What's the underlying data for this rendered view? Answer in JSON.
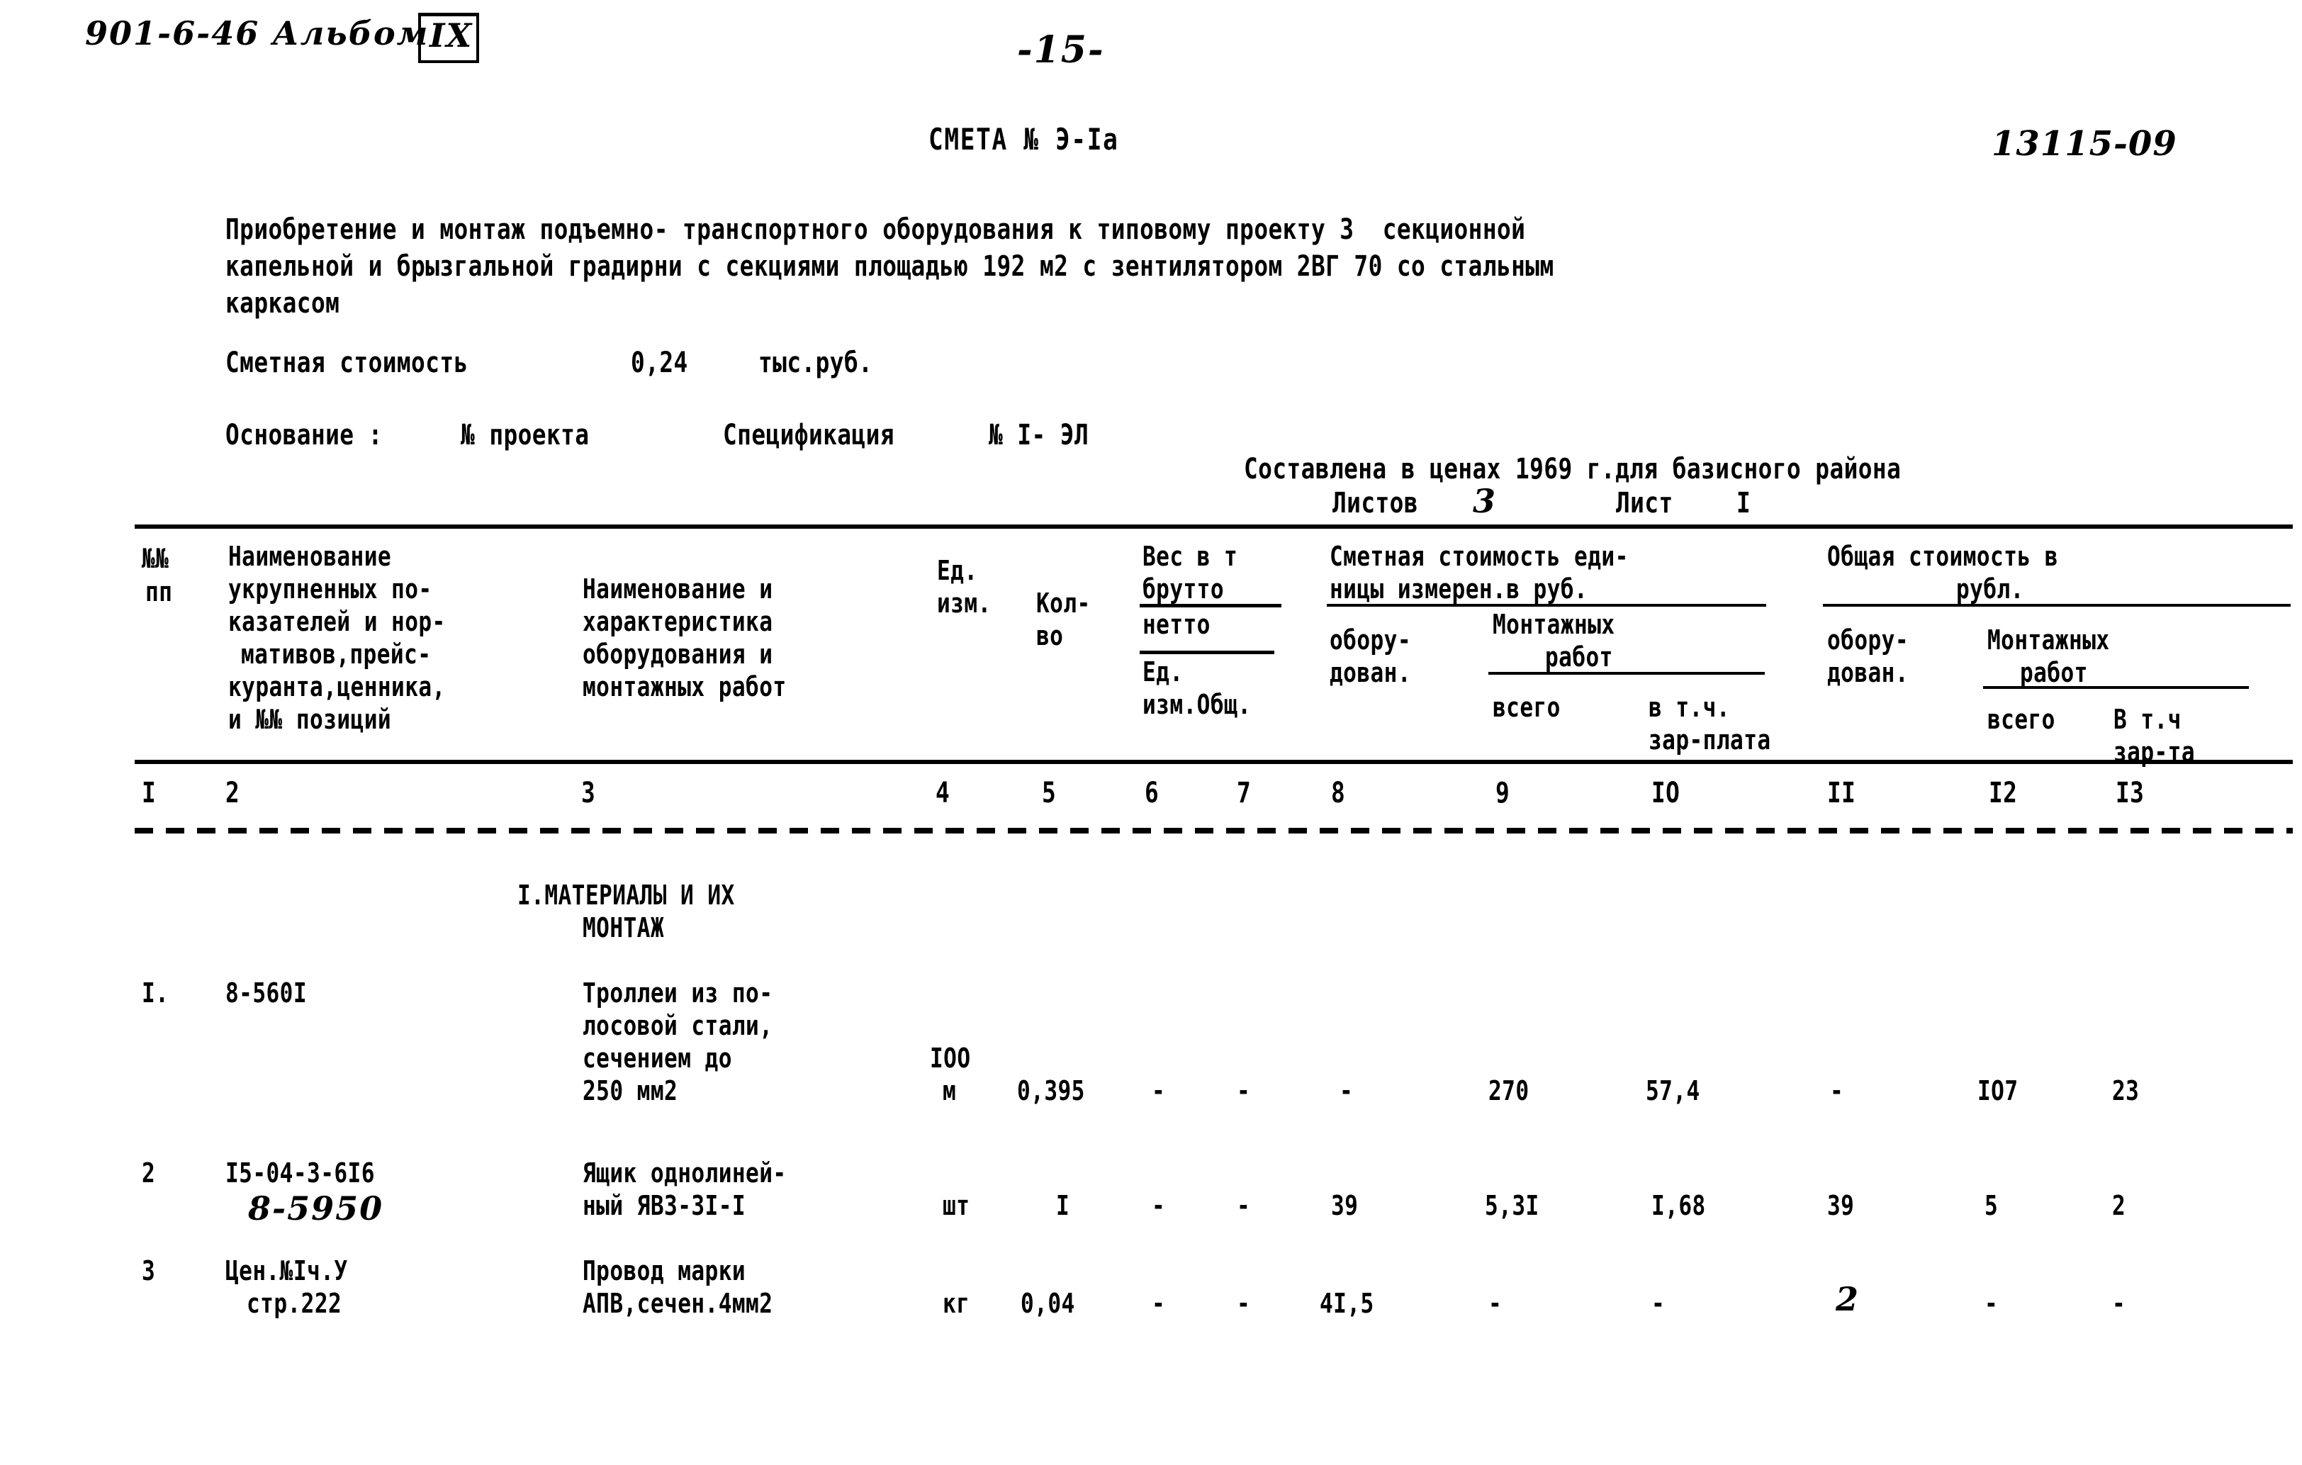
{
  "document": {
    "album_code": "901-6-46 Альбом",
    "album_number": "IX",
    "page_number": "-15-",
    "doc_number_handwritten": "13115-09",
    "title": "СМЕТА № Э-Iа",
    "description_lines": [
      "Приобретение и монтаж подъемно- транспортного оборудования к типовому проекту 3  секционной",
      "капельной и брызгальной градирни с секциями площадью 192 м2 с зентилятором 2ВГ 70 со стальным",
      "каркасом"
    ],
    "estimate_cost_label": "Сметная стоимость",
    "estimate_cost_value": "0,24",
    "estimate_cost_unit": "тыс.руб.",
    "basis_label": "Основание :",
    "basis_project": "№ проекта",
    "basis_spec_label": "Спецификация",
    "basis_spec_value": "№ I- ЭЛ",
    "prices_note": "Составлена в ценах 1969 г.для базисного района",
    "sheets_label": "Листов",
    "sheets_value": "3",
    "sheet_label": "Лист",
    "sheet_value": "I"
  },
  "table": {
    "headers": {
      "col1": [
        "№№",
        "пп"
      ],
      "col2": [
        "Наименование",
        "укрупненных по-",
        "казателей и нор-",
        "мативов,прейс-",
        "куранта,ценника,",
        "и №№ позиций"
      ],
      "col3": [
        "Наименование и",
        "характеристика",
        "оборудования и",
        "монтажных работ"
      ],
      "col4": [
        "Ед.",
        "изм."
      ],
      "col5": [
        "Кол-",
        "во"
      ],
      "col6_7": {
        "top": "Вес в т",
        "brutto": "брутто",
        "netto": "нетто",
        "ed": "Ед.",
        "izm_obsh": "изм.Общ."
      },
      "col8_10": {
        "top_line1": "Сметная стоимость еди-",
        "top_line2": "ницы измерен.в руб.",
        "equipment": [
          "обору-",
          "дован."
        ],
        "montage_line1": "Монтажных",
        "montage_line2": "работ",
        "total": "всего",
        "of_which_line1": "в т.ч.",
        "of_which_line2": "зар-плата"
      },
      "col11_13": {
        "top_line1": "Общая стоимость в",
        "top_line2": "рубл.",
        "equipment": [
          "обору-",
          "дован."
        ],
        "montage_line1": "Монтажных",
        "montage_line2": "работ",
        "total": "всего",
        "of_which_line1": "В т.ч",
        "of_which_line2": "зар-та"
      }
    },
    "column_numbers": [
      "I",
      "2",
      "3",
      "4",
      "5",
      "6",
      "7",
      "8",
      "9",
      "IO",
      "II",
      "I2",
      "I3"
    ],
    "section_title": [
      "I.МАТЕРИАЛЫ И ИХ",
      "МОНТАЖ"
    ],
    "rows": [
      {
        "no": "I.",
        "code": "8-560I",
        "code_handwritten": "",
        "name_lines": [
          "Троллеи из по-",
          "лосовой стали,",
          "сечением до",
          "250 мм2"
        ],
        "unit_top": "IOO",
        "unit": "м",
        "qty": "0,395",
        "weight_brutto": "-",
        "weight_netto": "-",
        "unit_cost_equipment": "-",
        "unit_cost_montage_total": "270",
        "unit_cost_montage_salary": "57,4",
        "total_equipment": "-",
        "total_montage": "IO7",
        "total_salary": "23"
      },
      {
        "no": "2",
        "code": "I5-04-3-6I6",
        "code_handwritten": "8-5950",
        "name_lines": [
          "Ящик однолиней-",
          "ный ЯВЗ-3I-I"
        ],
        "unit_top": "",
        "unit": "шт",
        "qty": "I",
        "weight_brutto": "-",
        "weight_netto": "-",
        "unit_cost_equipment": "39",
        "unit_cost_montage_total": "5,3I",
        "unit_cost_montage_salary": "I,68",
        "total_equipment": "39",
        "total_montage": "5",
        "total_salary": "2"
      },
      {
        "no": "3",
        "code": "Цен.№Iч.У",
        "code_line2": "стр.222",
        "code_handwritten": "",
        "name_lines": [
          "Провод марки",
          "АПВ,сечен.4мм2"
        ],
        "unit_top": "",
        "unit": "кг",
        "qty": "0,04",
        "weight_brutto": "-",
        "weight_netto": "-",
        "unit_cost_equipment": "4I,5",
        "unit_cost_montage_total": "-",
        "unit_cost_montage_salary": "-",
        "total_equipment": "2",
        "total_montage": "-",
        "total_salary": "-"
      }
    ]
  }
}
